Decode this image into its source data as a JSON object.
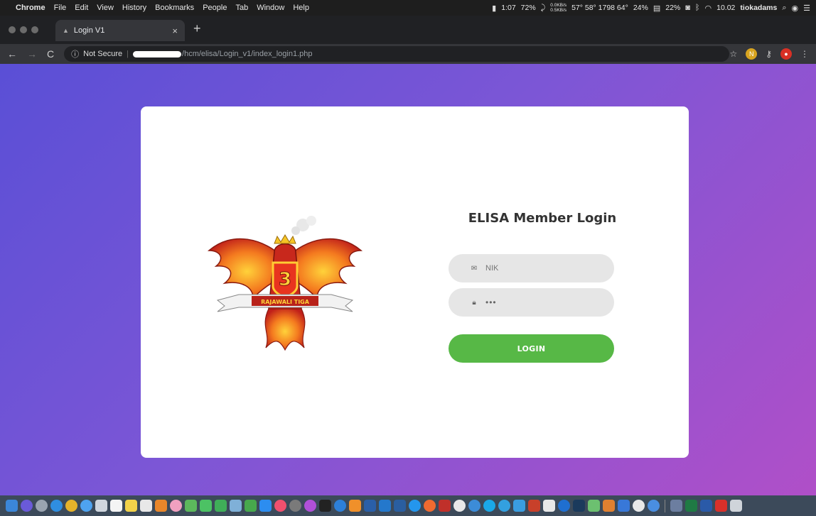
{
  "menubar": {
    "app_name": "Chrome",
    "items": [
      "File",
      "Edit",
      "View",
      "History",
      "Bookmarks",
      "People",
      "Tab",
      "Window",
      "Help"
    ],
    "battery_time": "1:07",
    "battery_pct": "72%",
    "net_up": "0.0KB/s",
    "net_down": "0.5KB/s",
    "stats": "57° 58° 1798 64°",
    "cpu_pct": "24%",
    "mem_pct": "22%",
    "clock": "10.02",
    "user": "tiokadams"
  },
  "tab": {
    "title": "Login V1",
    "close": "×",
    "new_tab": "+"
  },
  "toolbar": {
    "security_label": "Not Secure",
    "url_path": "/hcm/elisa/Login_v1/index_login1.php",
    "star_icon": "☆"
  },
  "login": {
    "title": "ELISA Member Login",
    "nik_placeholder": "NIK",
    "password_value": "•••",
    "button_label": "LOGIN"
  },
  "logo": {
    "number": "3",
    "banner_text": "RAJAWALI TIGA"
  },
  "colors": {
    "accent_green": "#57b846",
    "gradient_start": "#5a4fd6",
    "gradient_end": "#b04fc8"
  },
  "icons": {
    "nik_field": "envelope-icon",
    "password_field": "lock-icon"
  }
}
